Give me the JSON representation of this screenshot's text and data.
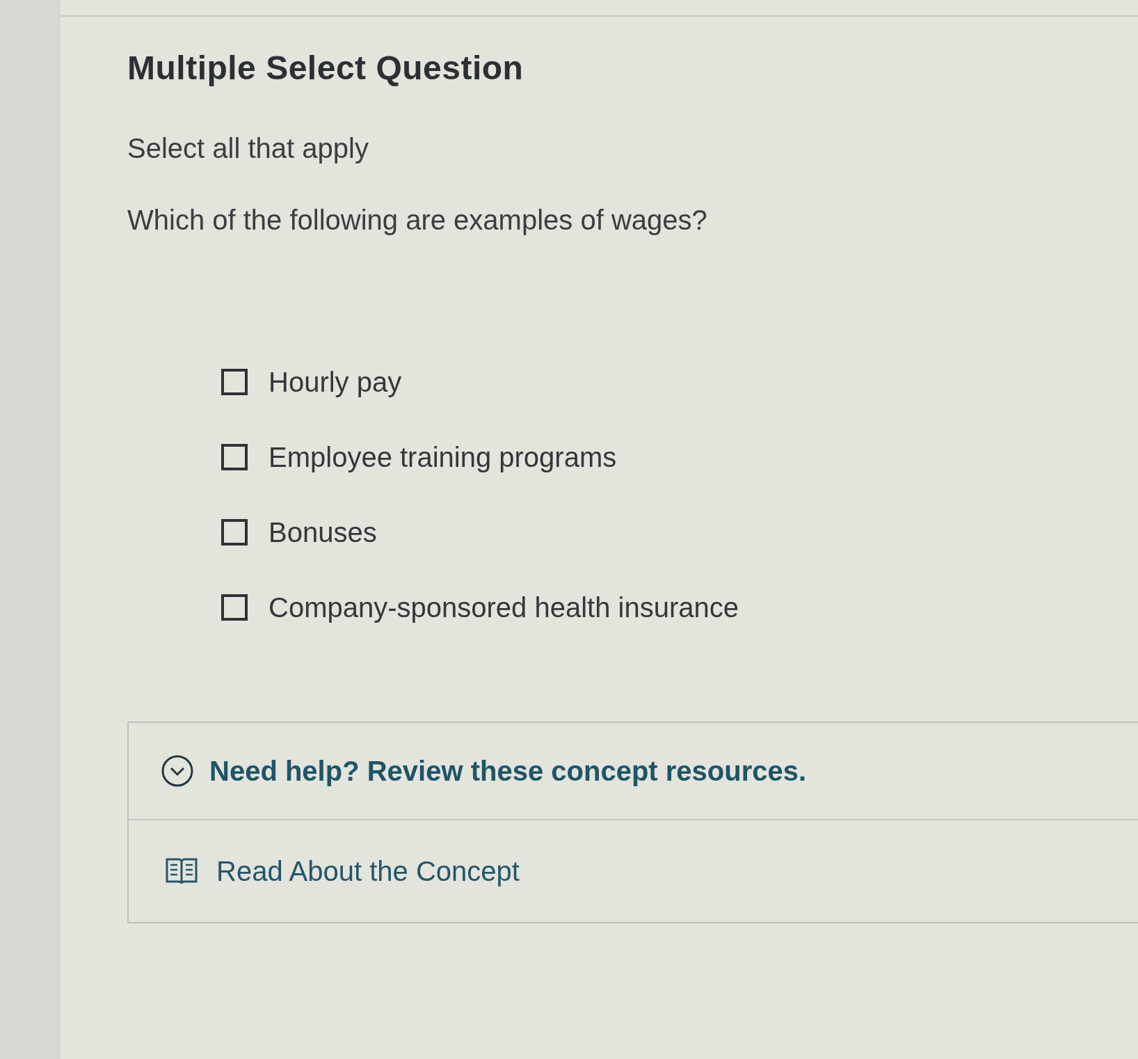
{
  "question": {
    "type_label": "Multiple Select Question",
    "instruction": "Select all that apply",
    "prompt": "Which of the following are examples of wages?"
  },
  "options": [
    {
      "label": "Hourly pay",
      "checked": false
    },
    {
      "label": "Employee training programs",
      "checked": false
    },
    {
      "label": "Bonuses",
      "checked": false
    },
    {
      "label": "Company-sponsored health insurance",
      "checked": false
    }
  ],
  "help": {
    "title": "Need help? Review these concept resources.",
    "expanded": false,
    "resources": [
      {
        "label": "Read About the Concept"
      }
    ]
  }
}
